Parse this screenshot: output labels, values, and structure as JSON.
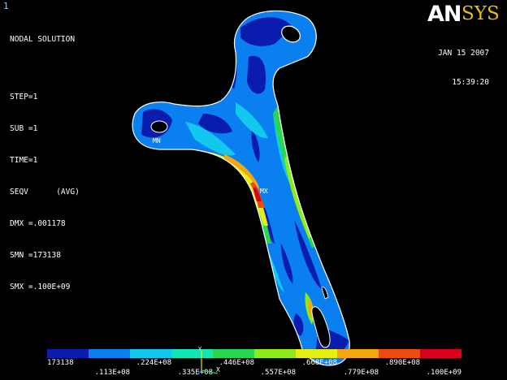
{
  "window_number": "1",
  "info": {
    "title": "NODAL SOLUTION",
    "step": "STEP=1",
    "sub": "SUB =1",
    "time": "TIME=1",
    "seqv": "SEQV      (AVG)",
    "dmx": "DMX =.001178",
    "smn": "SMN =173138",
    "smx": "SMX =.100E+09"
  },
  "logo": {
    "part1": "AN",
    "part2": "SYS"
  },
  "date": {
    "line1": "JAN 15 2007",
    "line2": "15:39:20"
  },
  "markers": {
    "mn": "MN",
    "mx": "MX"
  },
  "triad": {
    "y": "Y",
    "x": "X"
  },
  "legend": {
    "colors": [
      "#0a1cae",
      "#0a7ff0",
      "#12c8ee",
      "#10e6b4",
      "#27d84f",
      "#8cec17",
      "#e7ee11",
      "#f6a60e",
      "#ed4b10",
      "#d8001a"
    ],
    "top_labels": [
      "173138",
      ".224E+08",
      ".446E+08",
      ".668E+08",
      ".890E+08"
    ],
    "bottom_labels": [
      ".113E+08",
      ".335E+08",
      ".557E+08",
      ".779E+08",
      ".100E+09"
    ]
  }
}
